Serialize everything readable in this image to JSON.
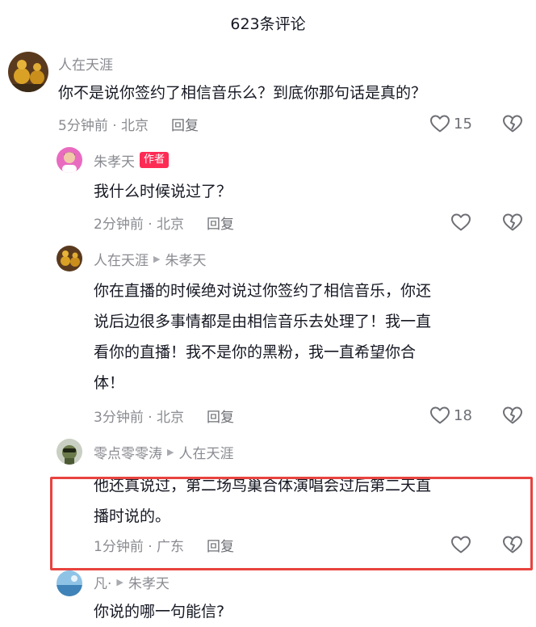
{
  "header": {
    "title": "623条评论"
  },
  "comments": [
    {
      "user": "人在天涯",
      "text": "你不是说你签约了相信音乐么？到底你那句话是真的？",
      "meta": "5分钟前 · 北京",
      "reply_label": "回复",
      "likes": "15"
    },
    {
      "user": "朱孝天",
      "badge": "作者",
      "text": "我什么时候说过了？",
      "meta": "2分钟前 · 北京",
      "reply_label": "回复",
      "likes": ""
    },
    {
      "user": "人在天涯",
      "reply_to": "朱孝天",
      "text_lines": [
        "你在直播的时候绝对说过你签约了相信音乐，你还",
        "说后边很多事情都是由相信音乐去处理了！我一直",
        "看你的直播！我不是你的黑粉，我一直希望你合",
        "体！"
      ],
      "meta": "3分钟前 · 北京",
      "reply_label": "回复",
      "likes": "18"
    },
    {
      "user": "零点零零涛",
      "reply_to": "人在天涯",
      "text_lines": [
        "他还真说过，第二场鸟巢合体演唱会过后第二天直",
        "播时说的。"
      ],
      "meta": "1分钟前 · 广东",
      "reply_label": "回复",
      "likes": ""
    },
    {
      "user": "凡·",
      "reply_to": "朱孝天",
      "text": "你说的哪一句能信?"
    }
  ],
  "icons": {
    "like": "heart-outline-icon",
    "dislike": "broken-heart-icon",
    "reply_arrow": "triangle-right-icon"
  },
  "colors": {
    "badge": "#fe2c55",
    "highlight": "#e8433f"
  }
}
